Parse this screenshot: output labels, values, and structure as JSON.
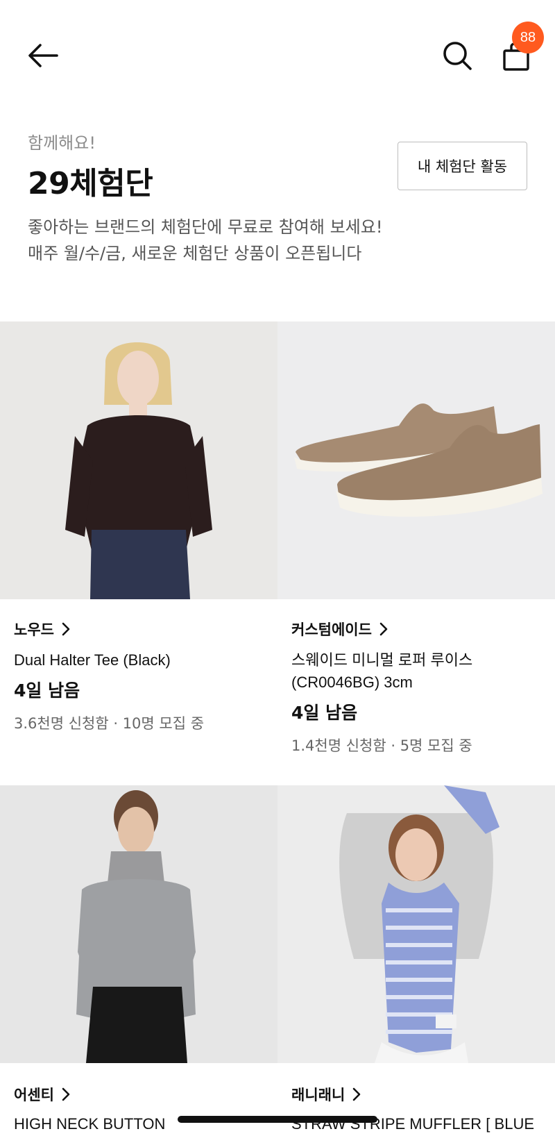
{
  "header": {
    "cart_count": "88",
    "eyebrow": "함께해요!",
    "title": "29체험단",
    "my_activity_label": "내 체험단 활동",
    "desc_line1": "좋아하는 브랜드의 체험단에 무료로 참여해 보세요!",
    "desc_line2": "매주 월/수/금, 새로운 체험단 상품이 오픈됩니다"
  },
  "products": [
    {
      "brand": "노우드",
      "name_line1": "Dual Halter Tee (Black)",
      "name_line2": "",
      "days_left": "4일 남음",
      "applicants": "3.6천명 신청함 · 10명 모집 중"
    },
    {
      "brand": "커스텀에이드",
      "name_line1": "스웨이드 미니멀 로퍼 루이스",
      "name_line2": "(CR0046BG) 3cm",
      "days_left": "4일 남음",
      "applicants": "1.4천명 신청함 · 5명 모집 중"
    },
    {
      "brand": "어센티",
      "name_line1": "HIGH NECK BUTTON",
      "name_line2": "",
      "days_left": "",
      "applicants": ""
    },
    {
      "brand": "래니래니",
      "name_line1": "STRAW STRIPE MUFFLER [ BLUE",
      "name_line2": "",
      "days_left": "",
      "applicants": ""
    }
  ],
  "colors": {
    "accent_badge": "#ff5a1f",
    "muted_text": "#8c8c8c"
  },
  "icons": {
    "back": "arrow-left-icon",
    "search": "search-icon",
    "bag": "shopping-bag-icon",
    "brand_chevron": "chevron-right-icon"
  }
}
